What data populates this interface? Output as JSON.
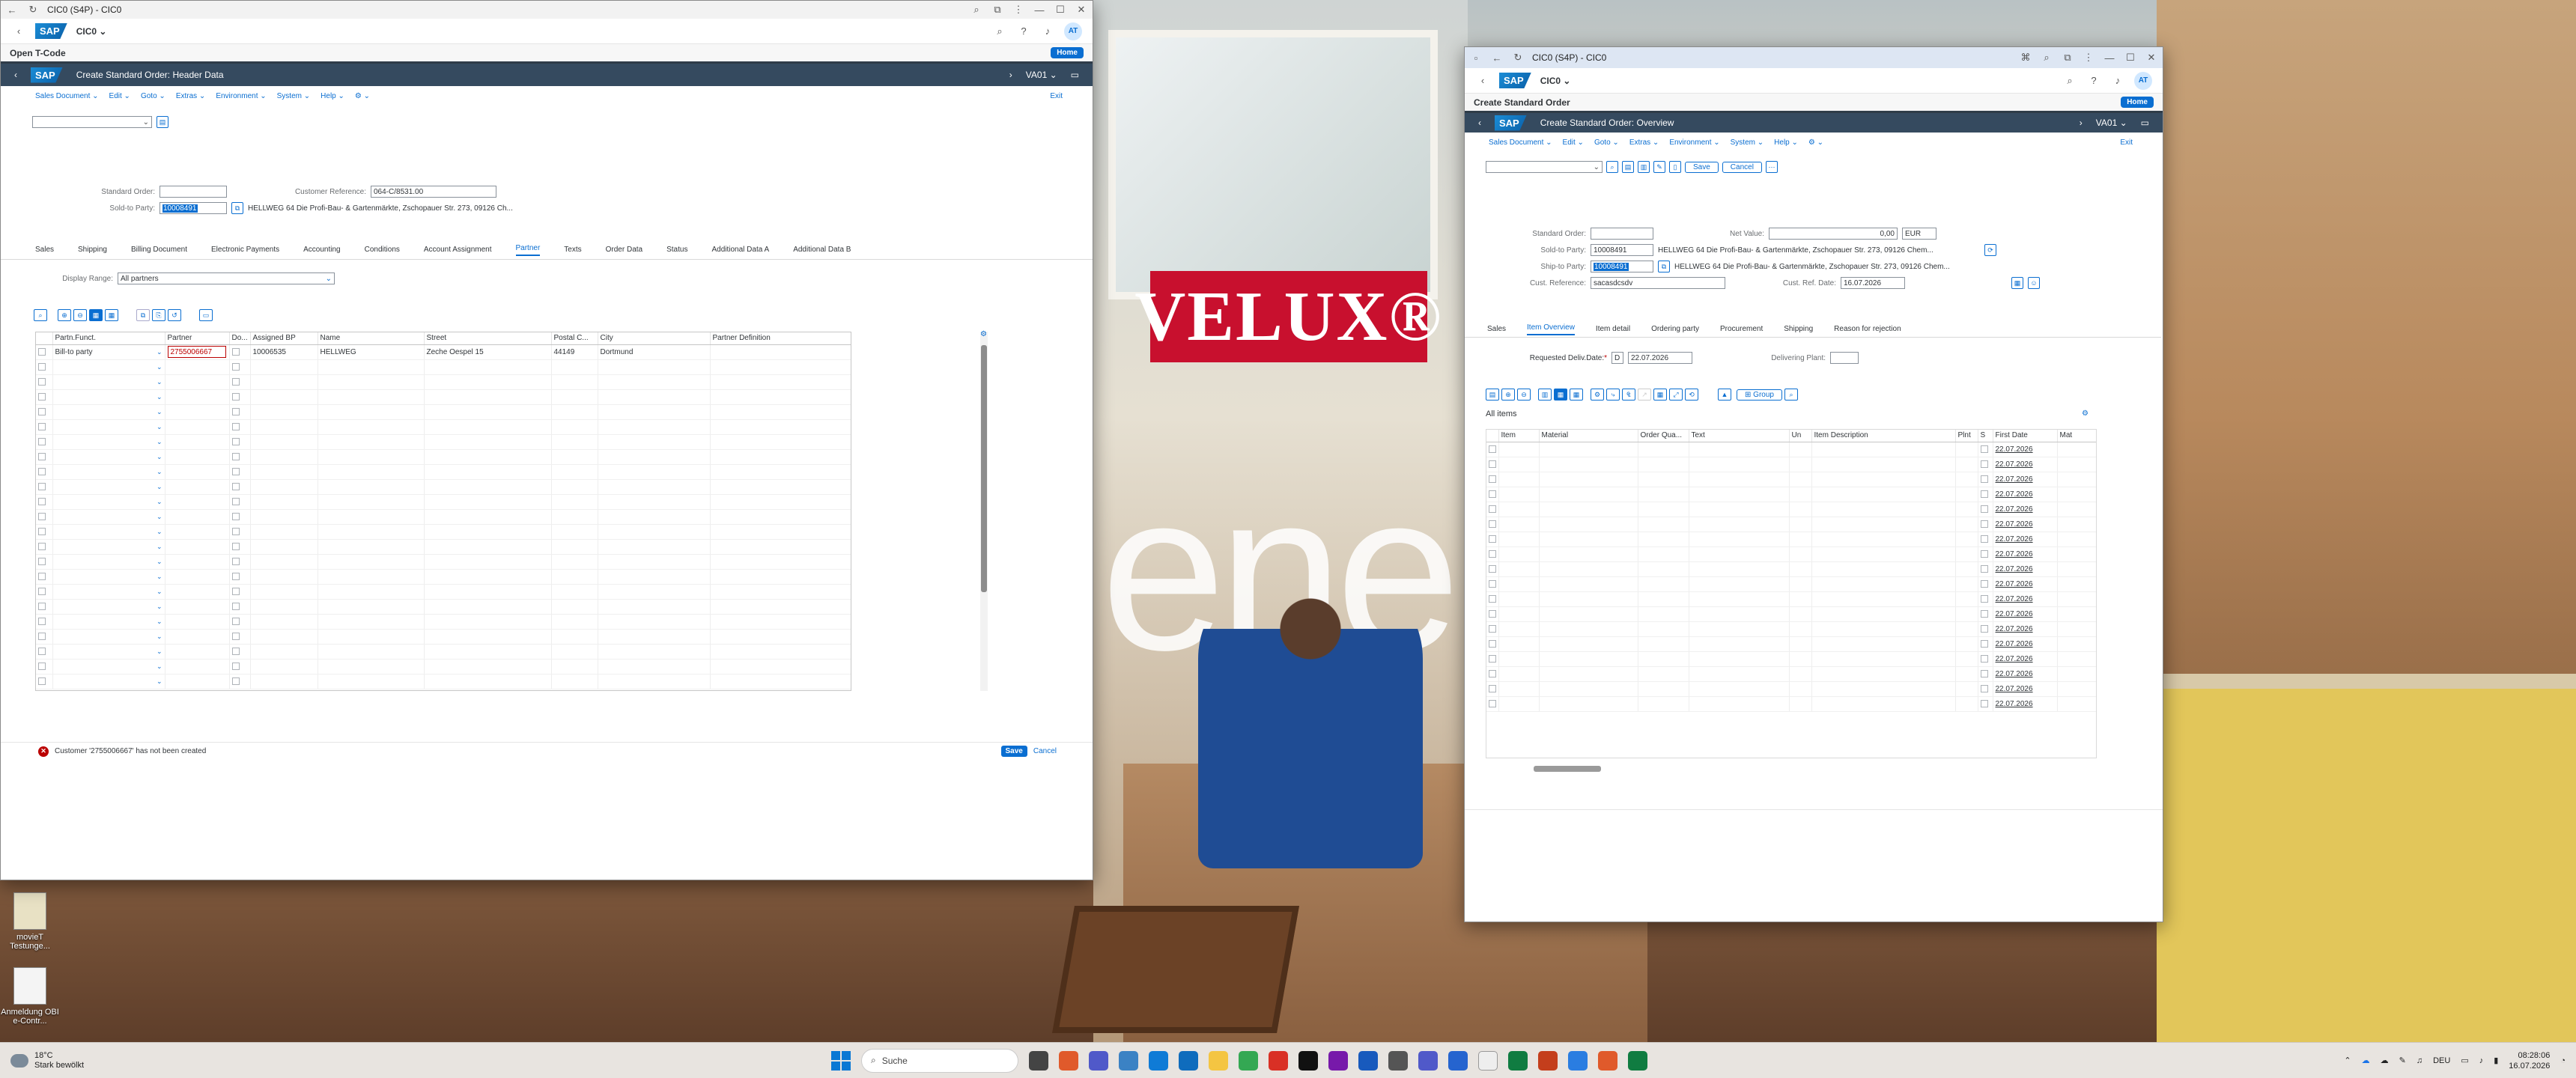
{
  "desktop": {
    "brand_logo": "VELUX®",
    "icons": [
      {
        "label": "movieT Testunge..."
      },
      {
        "label": "Anmeldung OBI e-Contr..."
      }
    ]
  },
  "left_window": {
    "title": "CIC0 (S4P) - CIC0",
    "system": "CIC0",
    "avatar": "AT",
    "open_tcode": "Open T-Code",
    "home": "Home",
    "app_title": "Create Standard Order: Header Data",
    "tcode": "VA01",
    "menu": [
      "Sales Document",
      "Edit",
      "Goto",
      "Extras",
      "Environment",
      "System",
      "Help"
    ],
    "exit": "Exit",
    "standard_order_label": "Standard Order:",
    "standard_order_value": "",
    "cust_ref_label": "Customer Reference:",
    "cust_ref_value": "064-C/8531.00",
    "sold_to_label": "Sold-to Party:",
    "sold_to_value": "10008491",
    "sold_to_desc": "HELLWEG 64 Die Profi-Bau- & Gartenmärkte, Zschopauer Str. 273, 09126 Ch...",
    "tabs": [
      "Sales",
      "Shipping",
      "Billing Document",
      "Electronic Payments",
      "Accounting",
      "Conditions",
      "Account Assignment",
      "Partner",
      "Texts",
      "Order Data",
      "Status",
      "Additional Data A",
      "Additional Data B"
    ],
    "active_tab": "Partner",
    "display_range_label": "Display Range:",
    "display_range_value": "All partners",
    "grid_headers": [
      "Partn.Funct.",
      "Partner",
      "Do...",
      "Assigned BP",
      "Name",
      "Street",
      "Postal C...",
      "City",
      "Partner Definition"
    ],
    "first_row": {
      "function": "Bill-to party",
      "partner": "2755006667",
      "assigned_bp": "10006535",
      "name": "HELLWEG",
      "street": "Zeche Oespel 15",
      "postal": "44149",
      "city": "Dortmund"
    },
    "status_message": "Customer '2755006667' has not been created",
    "save": "Save",
    "cancel": "Cancel"
  },
  "right_window": {
    "title": "CIC0 (S4P) - CIC0",
    "system": "CIC0",
    "avatar": "AT",
    "page_title": "Create Standard Order",
    "home": "Home",
    "app_title": "Create Standard Order: Overview",
    "tcode": "VA01",
    "menu": [
      "Sales Document",
      "Edit",
      "Goto",
      "Extras",
      "Environment",
      "System",
      "Help"
    ],
    "exit": "Exit",
    "save": "Save",
    "cancel": "Cancel",
    "standard_order_label": "Standard Order:",
    "net_value_label": "Net Value:",
    "net_value": "0,00",
    "currency": "EUR",
    "sold_to_label": "Sold-to Party:",
    "sold_to_value": "10008491",
    "sold_to_desc": "HELLWEG 64 Die Profi-Bau- & Gartenmärkte, Zschopauer Str. 273, 09126 Chem...",
    "ship_to_label": "Ship-to Party:",
    "ship_to_value": "10008491",
    "ship_to_desc": "HELLWEG 64 Die Profi-Bau- & Gartenmärkte, Zschopauer Str. 273, 09126 Chem...",
    "cust_ref_label": "Cust. Reference:",
    "cust_ref_value": "sacasdcsdv",
    "cust_ref_date_label": "Cust. Ref. Date:",
    "cust_ref_date": "16.07.2026",
    "tabs": [
      "Sales",
      "Item Overview",
      "Item detail",
      "Ordering party",
      "Procurement",
      "Shipping",
      "Reason for rejection"
    ],
    "active_tab": "Item Overview",
    "req_deliv_label": "Requested Deliv.Date:",
    "req_deliv_prefix": "D",
    "req_deliv_date": "22.07.2026",
    "delivering_plant_label": "Delivering Plant:",
    "group_btn": "Group",
    "all_items": "All items",
    "grid_headers": [
      "Item",
      "Material",
      "Order Qua...",
      "Text",
      "Un",
      "Item Description",
      "Plnt",
      "S",
      "First Date",
      "Mat"
    ],
    "row_date": "22.07.2026",
    "row_count": 18
  },
  "taskbar": {
    "temperature": "18°C",
    "weather": "Stark bewölkt",
    "search": "Suche",
    "language": "DEU",
    "time": "08:28:06",
    "date": "16.07.2026"
  }
}
